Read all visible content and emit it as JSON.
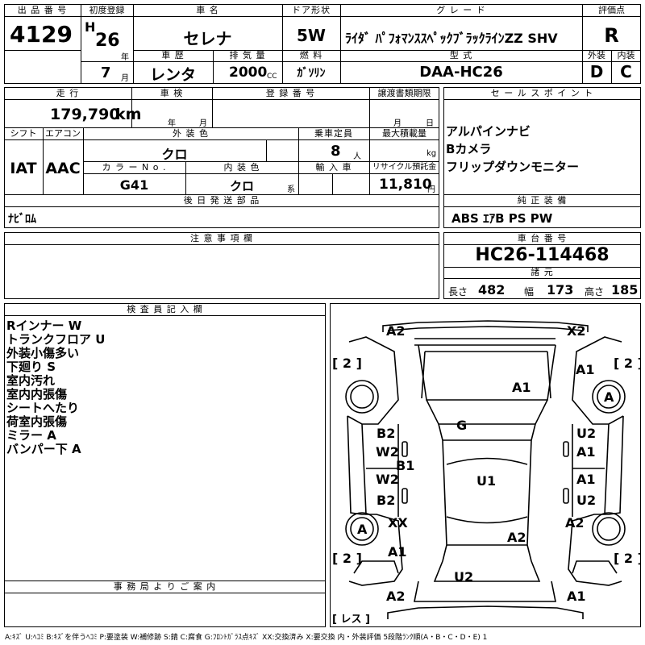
{
  "header": {
    "lot_label": "出 品 番 号",
    "lot_no": "4129",
    "reg_label": "初度登録",
    "era": "H",
    "reg_year": "26",
    "year_unit": "年",
    "reg_month": "7",
    "month_unit": "月",
    "name_label": "車 名",
    "car_name": "セレナ",
    "door_label": "ドア形状",
    "door": "5W",
    "grade_label": "グ レ ー ド",
    "grade": "ﾗｲﾀﾞ ﾊﾟﾌｫﾏﾝｽｽﾍﾟｯｸﾌﾞﾗｯｸﾗｲﾝZZ SHV",
    "history_label": "車 歴",
    "history": "レンタ",
    "disp_label": "排 気 量",
    "displacement": "2000",
    "disp_unit": "CC",
    "fuel_label": "燃 料",
    "fuel": "ｶﾞｿﾘﾝ",
    "model_label": "型 式",
    "model": "DAA-HC26",
    "score_label": "評価点",
    "score": "R",
    "ext_label": "外装",
    "ext": "D",
    "int_label": "内装",
    "int": "C"
  },
  "mid": {
    "mileage_label": "走 行",
    "mileage": "179,790",
    "mileage_unit": "km",
    "inspection_label": "車 検",
    "insp_year_unit": "年",
    "insp_month_unit": "月",
    "regno_label": "登 録 番 号",
    "transfer_label": "譲渡書類期限",
    "transfer_month_unit": "月",
    "transfer_day_unit": "日",
    "shift_label": "シフト",
    "shift": "IAT",
    "ac_label": "エアコン",
    "ac": "AAC",
    "ext_color_label": "外 装 色",
    "ext_color": "クロ",
    "capacity_label": "乗車定員",
    "capacity": "8",
    "capacity_unit": "人",
    "load_label": "最大積載量",
    "load_unit": "kg",
    "colorno_label": "カ ラ ー N o .",
    "color_no": "G41",
    "int_color_label": "内 装 色",
    "int_color": "クロ",
    "int_color_unit": "系",
    "import_label": "輸 入 車",
    "recycle_label": "リサイクル預託金",
    "recycle": "11,810",
    "recycle_unit": "円",
    "later_label": "後 日 発 送 部 品",
    "later": "ﾅﾋﾞﾛﾑ",
    "sales_label": "セ ー ル ス ポ イ ン ト",
    "sales": [
      "アルパインナビ",
      "Bカメラ",
      "フリップダウンモニター"
    ],
    "equip_label": "純 正 装 備",
    "equip": "ABS ｴｱB PS PW",
    "caution_label": "注 意 事 項 欄",
    "chassis_label": "車 台 番 号",
    "chassis": "HC26-114468",
    "spec_label": "諸 元",
    "len_label": "長さ",
    "length": "482",
    "wid_label": "幅",
    "width": "173",
    "hgt_label": "高さ",
    "height": "185"
  },
  "inspector": {
    "label": "検 査 員 記 入 欄",
    "notes": [
      "Rインナー W",
      "トランクフロア U",
      "外装小傷多い",
      "下廻り S",
      "室内汚れ",
      "室内内張傷",
      "シートへたり",
      "荷室内張傷",
      "ミラー A",
      "バンパー下 A"
    ]
  },
  "office_label": "事 務 局 よ り ご 案 内",
  "diagram": {
    "marks": {
      "a2_tl": "A2",
      "x2_tr": "X2",
      "br2_tl": "[ 2 ]",
      "br2_tr": "[ 2 ]",
      "br2_bl": "[ 2 ]",
      "br2_br": "[ 2 ]",
      "a1_hood": "A1",
      "a1_rf": "A1",
      "a_wheel_rf": "A",
      "g": "G",
      "b2_lf": "B2",
      "w2_lf": "W2",
      "b1_l": "B1",
      "w2_lr": "W2",
      "b2_lr": "B2",
      "u2_rf": "U2",
      "a1_rfd": "A1",
      "a1_rrd": "A1",
      "u2_rrd": "U2",
      "u1": "U1",
      "a_wheel_lr": "A",
      "xx": "XX",
      "a1_lr": "A1",
      "a2_roof": "A2",
      "a2_rr": "A2",
      "u2_rear": "U2",
      "a2_bl": "A2",
      "a1_br": "A1",
      "less": "[ レス ]"
    }
  },
  "legend": "A:ｷｽﾞ U:ﾍｺﾐ B:ｷｽﾞを伴うﾍｺﾐ P:要塗装 W:補修跡 S:錆 C:腐食 G:ﾌﾛﾝﾄｶﾞﾗｽ点ｷｽﾞ XX:交換済み X:要交換 内・外装評価 5段階ﾗﾝｸ順(A・B・C・D・E) 1"
}
